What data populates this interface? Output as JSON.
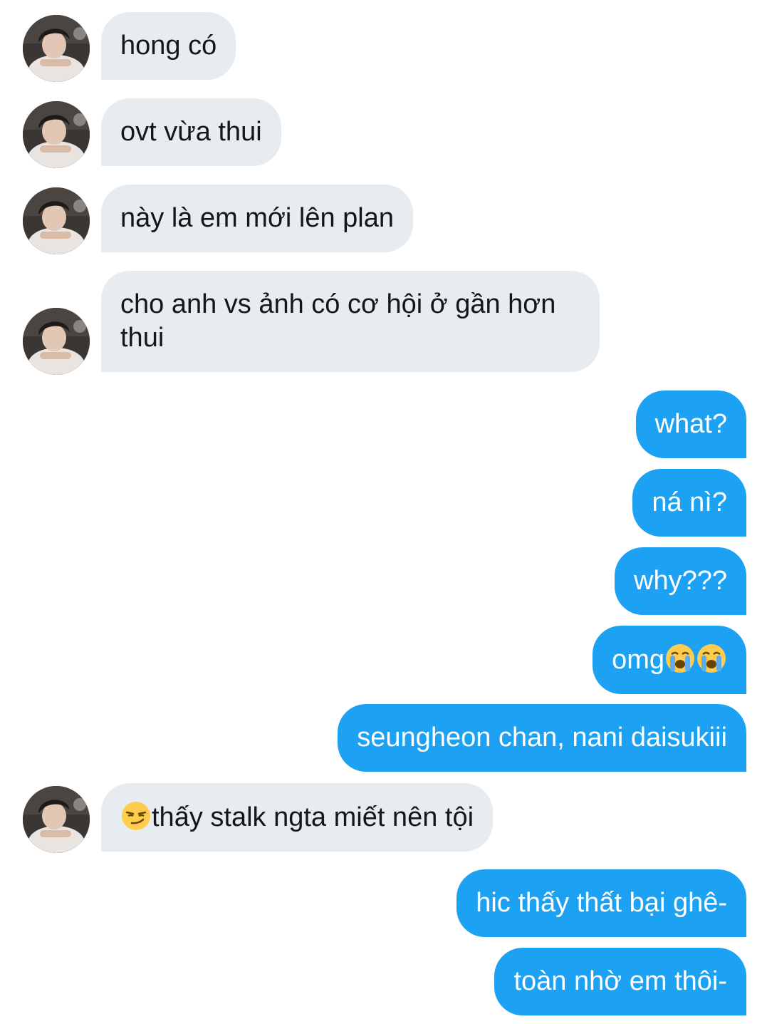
{
  "conversation": {
    "messages": [
      {
        "side": "in",
        "text": "hong có"
      },
      {
        "side": "in",
        "text": "ovt vừa thui"
      },
      {
        "side": "in",
        "text": "này là em mới lên plan"
      },
      {
        "side": "in",
        "text": "cho anh vs ảnh có cơ hội ở gần hơn thui"
      },
      {
        "side": "out",
        "text": "what?"
      },
      {
        "side": "out",
        "text": "ná nì?"
      },
      {
        "side": "out",
        "text": "why???"
      },
      {
        "side": "out",
        "text": "omg",
        "emoji_after": [
          "loudly-crying-face-emoji",
          "loudly-crying-face-emoji"
        ]
      },
      {
        "side": "out",
        "text": "seungheon chan, nani daisukiii"
      },
      {
        "side": "in",
        "text": "thấy stalk ngta miết nên tội",
        "emoji_before": [
          "smirking-face-emoji"
        ]
      },
      {
        "side": "out",
        "text": "hic thấy thất bại ghê-"
      },
      {
        "side": "out",
        "text": "toàn nhờ em thôi-"
      }
    ]
  },
  "colors": {
    "incoming_bubble": "#e6ecf0",
    "incoming_text": "#14171a",
    "outgoing_bubble": "#1da1f2",
    "outgoing_text": "#ffffff"
  }
}
